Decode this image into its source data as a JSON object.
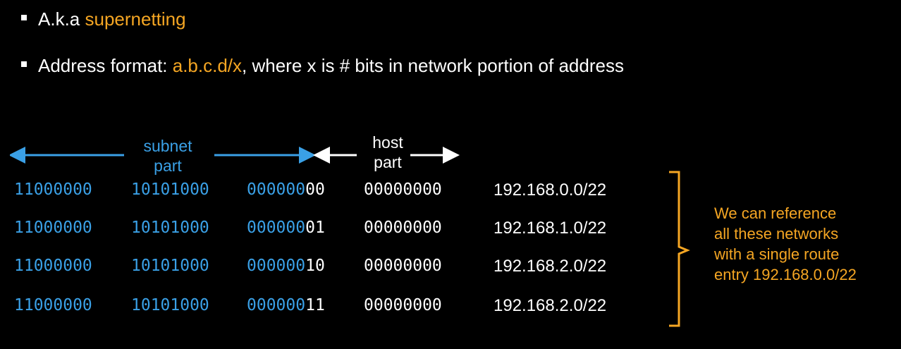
{
  "bullets": [
    {
      "prefix": "A.k.a ",
      "highlight": "supernetting",
      "suffix": ""
    },
    {
      "prefix": "Address format: ",
      "highlight": "a.b.c.d/x",
      "suffix": ", where x is # bits in network portion of address"
    }
  ],
  "header": {
    "subnet_label_line1": "subnet",
    "subnet_label_line2": "part",
    "host_label_line1": "host",
    "host_label_line2": "part"
  },
  "rows": [
    {
      "octet1": "11000000",
      "octet2": "10101000",
      "octet3_net": "000000",
      "octet3_host": "00",
      "octet4": "00000000",
      "ip": "192.168.0.0/22"
    },
    {
      "octet1": "11000000",
      "octet2": "10101000",
      "octet3_net": "000000",
      "octet3_host": "01",
      "octet4": "00000000",
      "ip": "192.168.1.0/22"
    },
    {
      "octet1": "11000000",
      "octet2": "10101000",
      "octet3_net": "000000",
      "octet3_host": "10",
      "octet4": "00000000",
      "ip": "192.168.2.0/22"
    },
    {
      "octet1": "11000000",
      "octet2": "10101000",
      "octet3_net": "000000",
      "octet3_host": "11",
      "octet4": "00000000",
      "ip": "192.168.2.0/22"
    }
  ],
  "note": {
    "lines": [
      "We can reference",
      "all these networks",
      "with a single route",
      "entry 192.168.0.0/22"
    ]
  },
  "colors": {
    "background": "#000000",
    "subnet_blue": "#3aa0e6",
    "highlight_orange": "#f5a623",
    "text_white": "#ffffff"
  }
}
